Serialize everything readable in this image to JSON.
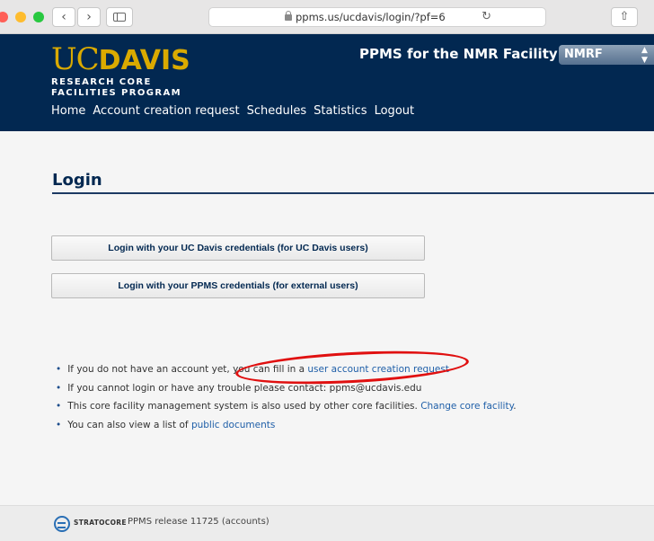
{
  "browser": {
    "url": "ppms.us/ucdavis/login/?pf=6",
    "back_glyph": "‹",
    "forward_glyph": "›",
    "reload_glyph": "↻",
    "share_glyph": "⇧"
  },
  "header": {
    "logo_uc": "UC",
    "logo_davis": "DAVIS",
    "logo_line1": "RESEARCH CORE",
    "logo_line2": "FACILITIES PROGRAM",
    "title": "PPMS for the NMR Facility -",
    "facility_selected": "NMRF",
    "select_arrows": "▲\n▼",
    "nav": [
      {
        "label": "Home"
      },
      {
        "label": "Account creation request"
      },
      {
        "label": "Schedules"
      },
      {
        "label": "Statistics"
      },
      {
        "label": "Logout"
      }
    ]
  },
  "main": {
    "title": "Login",
    "ucd_login_label": "Login with your UC Davis credentials (for UC Davis users)",
    "ppms_login_label": "Login with your PPMS credentials (for external users)",
    "info": {
      "line1_prefix": "If you do not have an account yet, you can fill in a ",
      "line1_link": "user account creation request",
      "line2": "If you cannot login or have any trouble please contact: ppms@ucdavis.edu",
      "line3_prefix": "This core facility management system is also used by other core facilities. ",
      "line3_link": "Change core facility",
      "line3_suffix": ".",
      "line4_prefix": "You can also view a list of ",
      "line4_link": "public documents"
    }
  },
  "footer": {
    "brand": "STRATOCORE",
    "release": "PPMS release 11725 (accounts)"
  },
  "colors": {
    "header_bg": "#022851",
    "logo_gold": "#daaa00",
    "link": "#1f5fa8",
    "annotation_red": "#e01010"
  }
}
